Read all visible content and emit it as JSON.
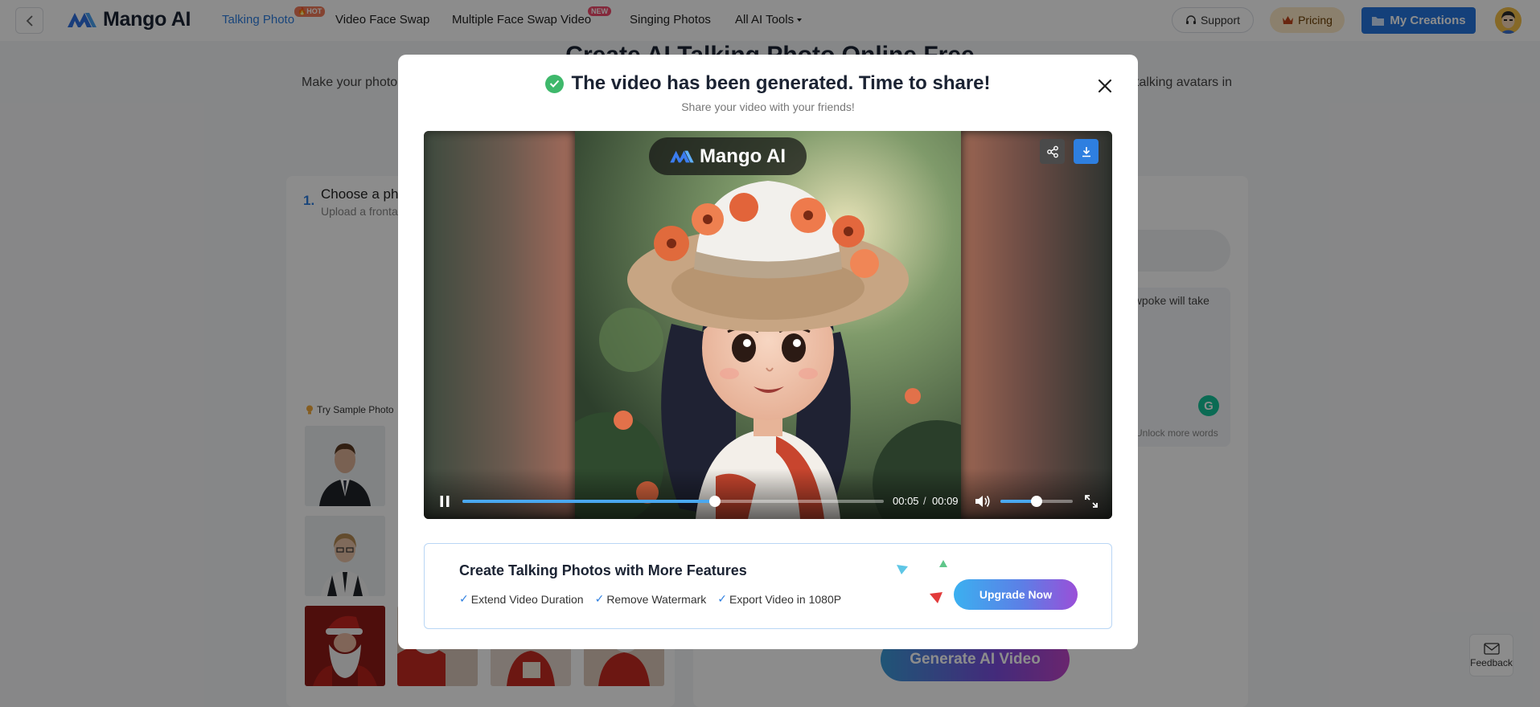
{
  "nav": {
    "brand": "Mango AI",
    "items": [
      {
        "label": "Talking Photo",
        "badge": "HOT",
        "active": true
      },
      {
        "label": "Video Face Swap"
      },
      {
        "label": "Multiple Face Swap Video",
        "badge": "NEW"
      },
      {
        "label": "Singing Photos"
      },
      {
        "label": "All AI Tools"
      }
    ],
    "support": "Support",
    "pricing": "Pricing",
    "my_creations": "My Creations"
  },
  "page": {
    "title": "Create AI Talking Photo Online Free",
    "description_left": "Make your photo",
    "description_right": "talking avatars in",
    "step_number": "1.",
    "step_title": "Choose a pho",
    "step_subtitle": "Upload a fronta",
    "sample_label": "Try Sample Photo",
    "script_fragment": "owpoke will take",
    "unlock_text": "Unlock more words",
    "generate_button": "Generate AI Video",
    "feedback": "Feedback"
  },
  "modal": {
    "title": "The video has been generated. Time to share!",
    "subtitle": "Share your video with your friends!",
    "watermark": "Mango AI",
    "player": {
      "current_time": "00:05",
      "separator": "/",
      "duration": "00:09",
      "progress": 0.6,
      "volume": 0.5
    },
    "promo": {
      "title": "Create Talking Photos with More Features",
      "features": [
        "Extend Video Duration",
        "Remove Watermark",
        "Export Video in 1080P"
      ],
      "cta": "Upgrade Now"
    }
  },
  "colors": {
    "accent": "#2576de",
    "success": "#3eb86b"
  }
}
